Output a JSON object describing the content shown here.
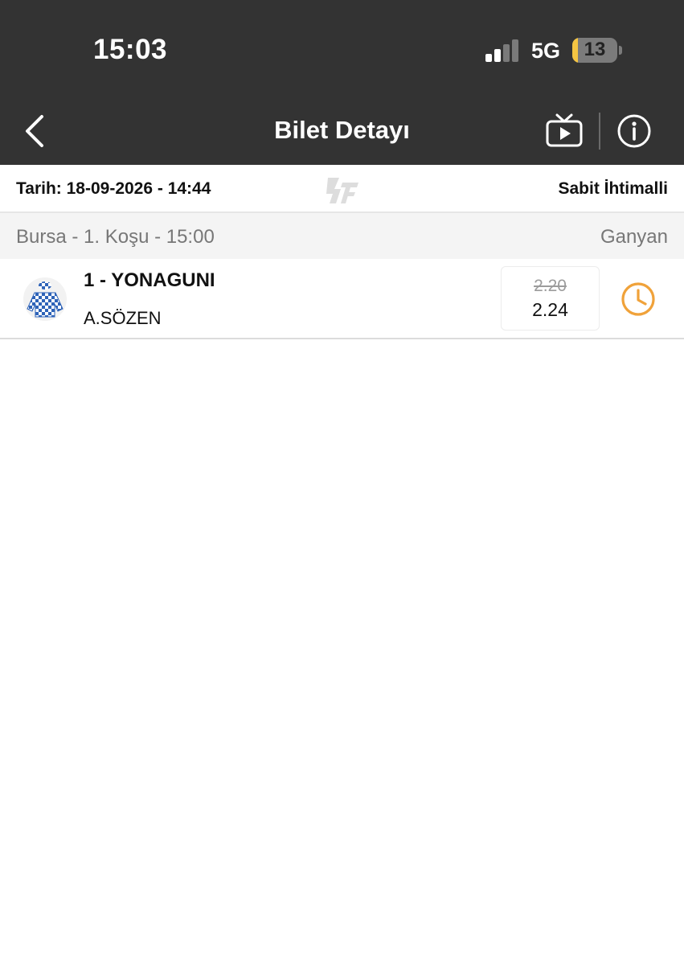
{
  "status_bar": {
    "time": "15:03",
    "network": "5G",
    "battery": "13",
    "colors": {
      "battery_fill": "#f5c542"
    }
  },
  "nav": {
    "title": "Bilet Detayı",
    "back_icon": "chevron-left-icon",
    "tv_icon": "tv-play-icon",
    "info_icon": "info-circle-icon"
  },
  "ticket": {
    "date": "Tarih: 18-09-2026 - 14:44",
    "type": "Sabit İhtimalli",
    "watermark_icon": "logo-watermark-icon"
  },
  "race": {
    "title": "Bursa - 1. Koşu - 15:00",
    "bet_type": "Ganyan"
  },
  "selection": {
    "horse": "1 - YONAGUNI",
    "jockey": "A.SÖZEN",
    "odds_old": "2.20",
    "odds_new": "2.24",
    "status_icon": "clock-icon",
    "colors": {
      "clock": "#f0a23a",
      "jersey_primary": "#2e63b8",
      "jersey_secondary": "#ffffff"
    }
  },
  "colors": {
    "header_bg": "#333333",
    "race_header_bg": "#f4f4f4"
  }
}
